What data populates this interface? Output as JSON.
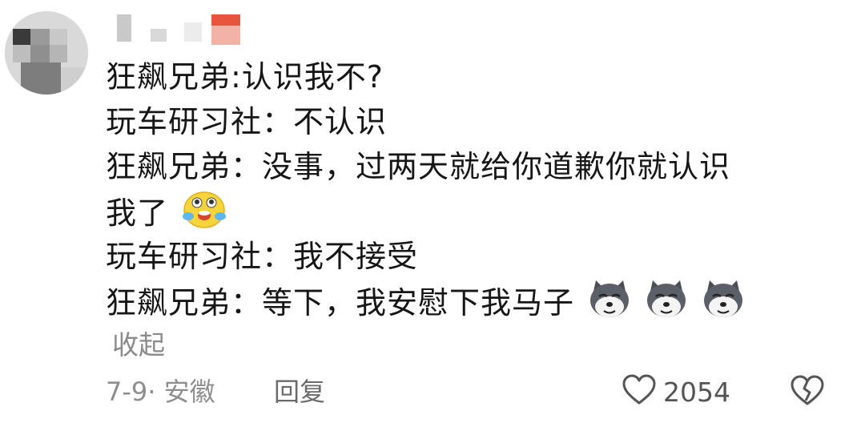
{
  "comment": {
    "lines": [
      "狂飙兄弟:认识我不?",
      "玩车研习社：不认识",
      "狂飙兄弟：没事，过两天就给你道歉你就认识",
      "我了",
      "玩车研习社：我不接受",
      "狂飙兄弟：等下，我安慰下我马子"
    ],
    "emojis": {
      "line_4": "laughing-crying-face-icon",
      "line_6": [
        "husky-dog-face-icon",
        "husky-dog-face-icon",
        "husky-dog-face-icon"
      ]
    }
  },
  "actions": {
    "collapse_label": "收起",
    "date_location": "7-9· 安徽",
    "reply_label": "回复",
    "like_count": "2054",
    "like_icon": "heart-outline-icon",
    "dislike_icon": "broken-heart-icon"
  },
  "colors": {
    "text": "#161616",
    "muted": "#8e8e8e",
    "icon": "#555555",
    "username_accent": "#e8553d"
  }
}
